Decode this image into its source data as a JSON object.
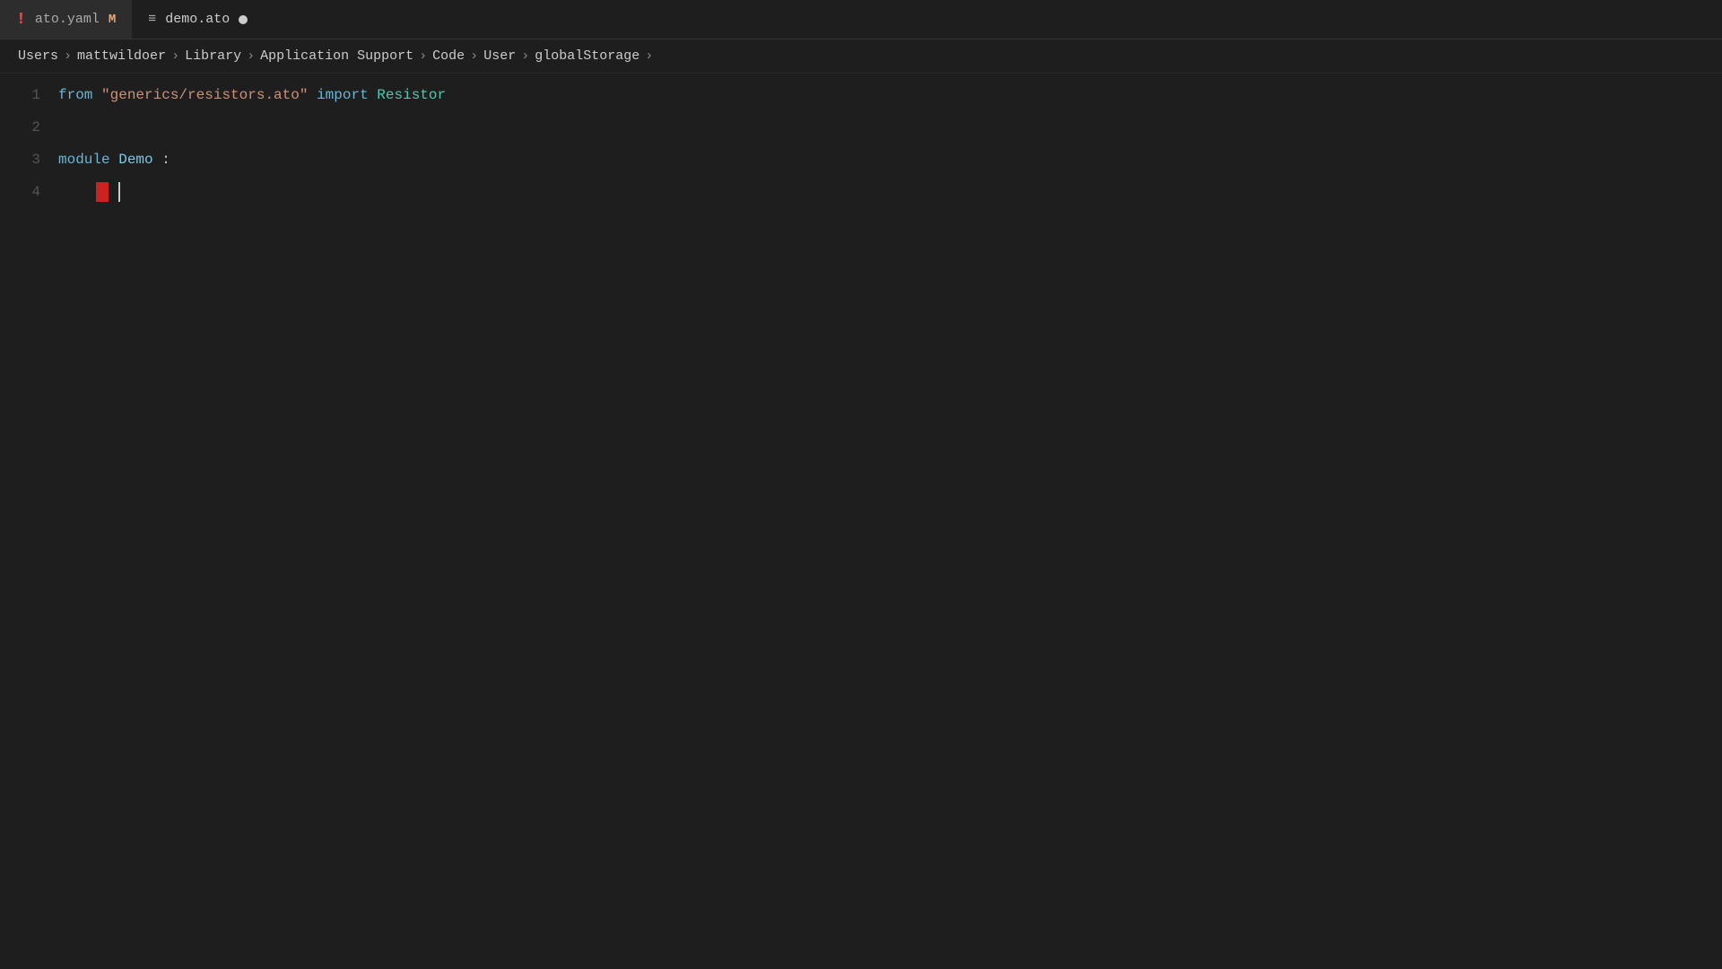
{
  "tabs": [
    {
      "id": "ato-yaml",
      "icon_type": "error",
      "icon_label": "!",
      "filename": "ato.yaml",
      "modifier": "M",
      "active": false
    },
    {
      "id": "demo-ato",
      "icon_type": "lines",
      "icon_label": "≡",
      "filename": "demo.ato",
      "modifier": "dot",
      "active": true
    }
  ],
  "breadcrumb": {
    "items": [
      "Users",
      "mattwildoer",
      "Library",
      "Application Support",
      "Code",
      "User",
      "globalStorage"
    ]
  },
  "code": {
    "lines": [
      {
        "number": "1",
        "tokens": [
          {
            "type": "kw-from",
            "text": "from"
          },
          {
            "type": "space",
            "text": " "
          },
          {
            "type": "kw-string",
            "text": "\"generics/resistors.ato\""
          },
          {
            "type": "space",
            "text": " "
          },
          {
            "type": "kw-import",
            "text": "import"
          },
          {
            "type": "space",
            "text": " "
          },
          {
            "type": "kw-resistor",
            "text": "Resistor"
          }
        ]
      },
      {
        "number": "2",
        "tokens": []
      },
      {
        "number": "3",
        "tokens": [
          {
            "type": "kw-module",
            "text": "module"
          },
          {
            "type": "space",
            "text": " "
          },
          {
            "type": "kw-name-demo",
            "text": "Demo"
          },
          {
            "type": "plain",
            "text": ":"
          }
        ]
      },
      {
        "number": "4",
        "tokens": [],
        "has_cursor": true
      }
    ]
  }
}
